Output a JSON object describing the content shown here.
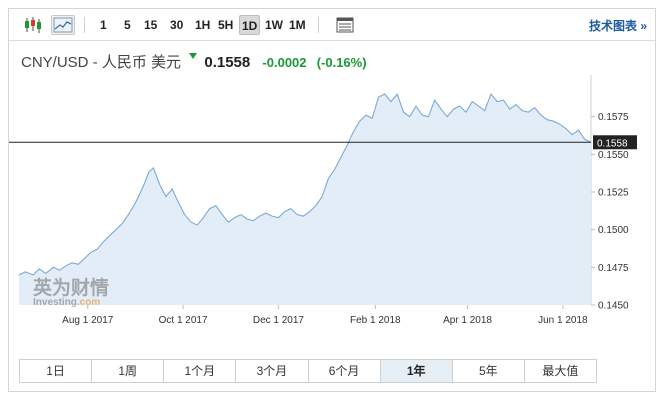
{
  "toolbar": {
    "intervals": [
      "1",
      "5",
      "15",
      "30",
      "1H",
      "5H",
      "1D",
      "1W",
      "1M"
    ],
    "active_interval": "1D",
    "tech_chart_link": "技术图表 »"
  },
  "quote": {
    "pair": "CNY/USD - 人民币 美元",
    "price": "0.1558",
    "change": "-0.0002",
    "change_pct": "(-0.16%)",
    "direction": "down"
  },
  "watermark": {
    "cn": "英为财情",
    "en_main": "Investing",
    "en_suffix": ".com"
  },
  "ranges": {
    "items": [
      "1日",
      "1周",
      "1个月",
      "3个月",
      "6个月",
      "1年",
      "5年",
      "最大值"
    ],
    "active": "1年"
  },
  "colors": {
    "line": "#7aaad6",
    "fill": "#e3edf7",
    "positive": "#1a9a35",
    "link": "#1e5aa0",
    "price_line": "#222222"
  },
  "chart_data": {
    "type": "area",
    "title": "",
    "xlabel": "",
    "ylabel": "",
    "x_ticks": [
      "Aug 1 2017",
      "Oct 1 2017",
      "Dec 1 2017",
      "Feb 1 2018",
      "Apr 1 2018",
      "Jun 1 2018"
    ],
    "x_tick_values": [
      "2017-08-01",
      "2017-10-01",
      "2017-12-01",
      "2018-02-01",
      "2018-04-01",
      "2018-06-01"
    ],
    "y_ticks": [
      0.145,
      0.1475,
      0.15,
      0.1525,
      0.155,
      0.1575
    ],
    "ylim": [
      0.145,
      0.16
    ],
    "xlim": [
      "2017-06-18",
      "2018-06-19"
    ],
    "current_price_label": "0.1558",
    "current_price": 0.1558,
    "grid": false,
    "series": [
      {
        "x": [
          "2017-06-18",
          "2017-06-22",
          "2017-06-27",
          "2017-07-01",
          "2017-07-05",
          "2017-07-10",
          "2017-07-14",
          "2017-07-18",
          "2017-07-22",
          "2017-07-26",
          "2017-07-30",
          "2017-08-03",
          "2017-08-07",
          "2017-08-11",
          "2017-08-15",
          "2017-08-19",
          "2017-08-23",
          "2017-08-27",
          "2017-08-31",
          "2017-09-03",
          "2017-09-06",
          "2017-09-09",
          "2017-09-12",
          "2017-09-16",
          "2017-09-20",
          "2017-09-24",
          "2017-09-28",
          "2017-10-02",
          "2017-10-06",
          "2017-10-10",
          "2017-10-14",
          "2017-10-18",
          "2017-10-22",
          "2017-10-26",
          "2017-10-30",
          "2017-11-03",
          "2017-11-07",
          "2017-11-11",
          "2017-11-15",
          "2017-11-19",
          "2017-11-23",
          "2017-11-27",
          "2017-12-01",
          "2017-12-05",
          "2017-12-09",
          "2017-12-13",
          "2017-12-17",
          "2017-12-21",
          "2017-12-25",
          "2017-12-29",
          "2018-01-02",
          "2018-01-06",
          "2018-01-10",
          "2018-01-14",
          "2018-01-18",
          "2018-01-22",
          "2018-01-26",
          "2018-01-30",
          "2018-02-03",
          "2018-02-07",
          "2018-02-11",
          "2018-02-15",
          "2018-02-19",
          "2018-02-23",
          "2018-02-27",
          "2018-03-03",
          "2018-03-07",
          "2018-03-11",
          "2018-03-15",
          "2018-03-19",
          "2018-03-23",
          "2018-03-27",
          "2018-03-31",
          "2018-04-04",
          "2018-04-08",
          "2018-04-12",
          "2018-04-16",
          "2018-04-20",
          "2018-04-24",
          "2018-04-28",
          "2018-05-02",
          "2018-05-06",
          "2018-05-10",
          "2018-05-14",
          "2018-05-18",
          "2018-05-22",
          "2018-05-26",
          "2018-05-30",
          "2018-06-03",
          "2018-06-07",
          "2018-06-11",
          "2018-06-15",
          "2018-06-19"
        ],
        "y": [
          0.147,
          0.1472,
          0.147,
          0.1474,
          0.1471,
          0.1475,
          0.1473,
          0.1476,
          0.1478,
          0.1477,
          0.1481,
          0.1485,
          0.1487,
          0.1492,
          0.1496,
          0.15,
          0.1504,
          0.151,
          0.1517,
          0.1523,
          0.153,
          0.1538,
          0.1541,
          0.153,
          0.1522,
          0.1527,
          0.1518,
          0.151,
          0.1505,
          0.1503,
          0.1508,
          0.1514,
          0.1516,
          0.151,
          0.1505,
          0.1508,
          0.151,
          0.1507,
          0.1506,
          0.1509,
          0.1511,
          0.1509,
          0.1508,
          0.1512,
          0.1514,
          0.151,
          0.1509,
          0.1512,
          0.1516,
          0.1522,
          0.1534,
          0.154,
          0.1548,
          0.1556,
          0.1565,
          0.1572,
          0.1576,
          0.1574,
          0.1588,
          0.159,
          0.1585,
          0.159,
          0.1578,
          0.1575,
          0.1582,
          0.1576,
          0.1575,
          0.1586,
          0.158,
          0.1575,
          0.158,
          0.1582,
          0.1578,
          0.1585,
          0.1582,
          0.1579,
          0.159,
          0.1585,
          0.1586,
          0.158,
          0.1583,
          0.1579,
          0.1578,
          0.1581,
          0.1576,
          0.1573,
          0.1572,
          0.157,
          0.1567,
          0.1563,
          0.1566,
          0.156,
          0.1558
        ]
      }
    ]
  }
}
